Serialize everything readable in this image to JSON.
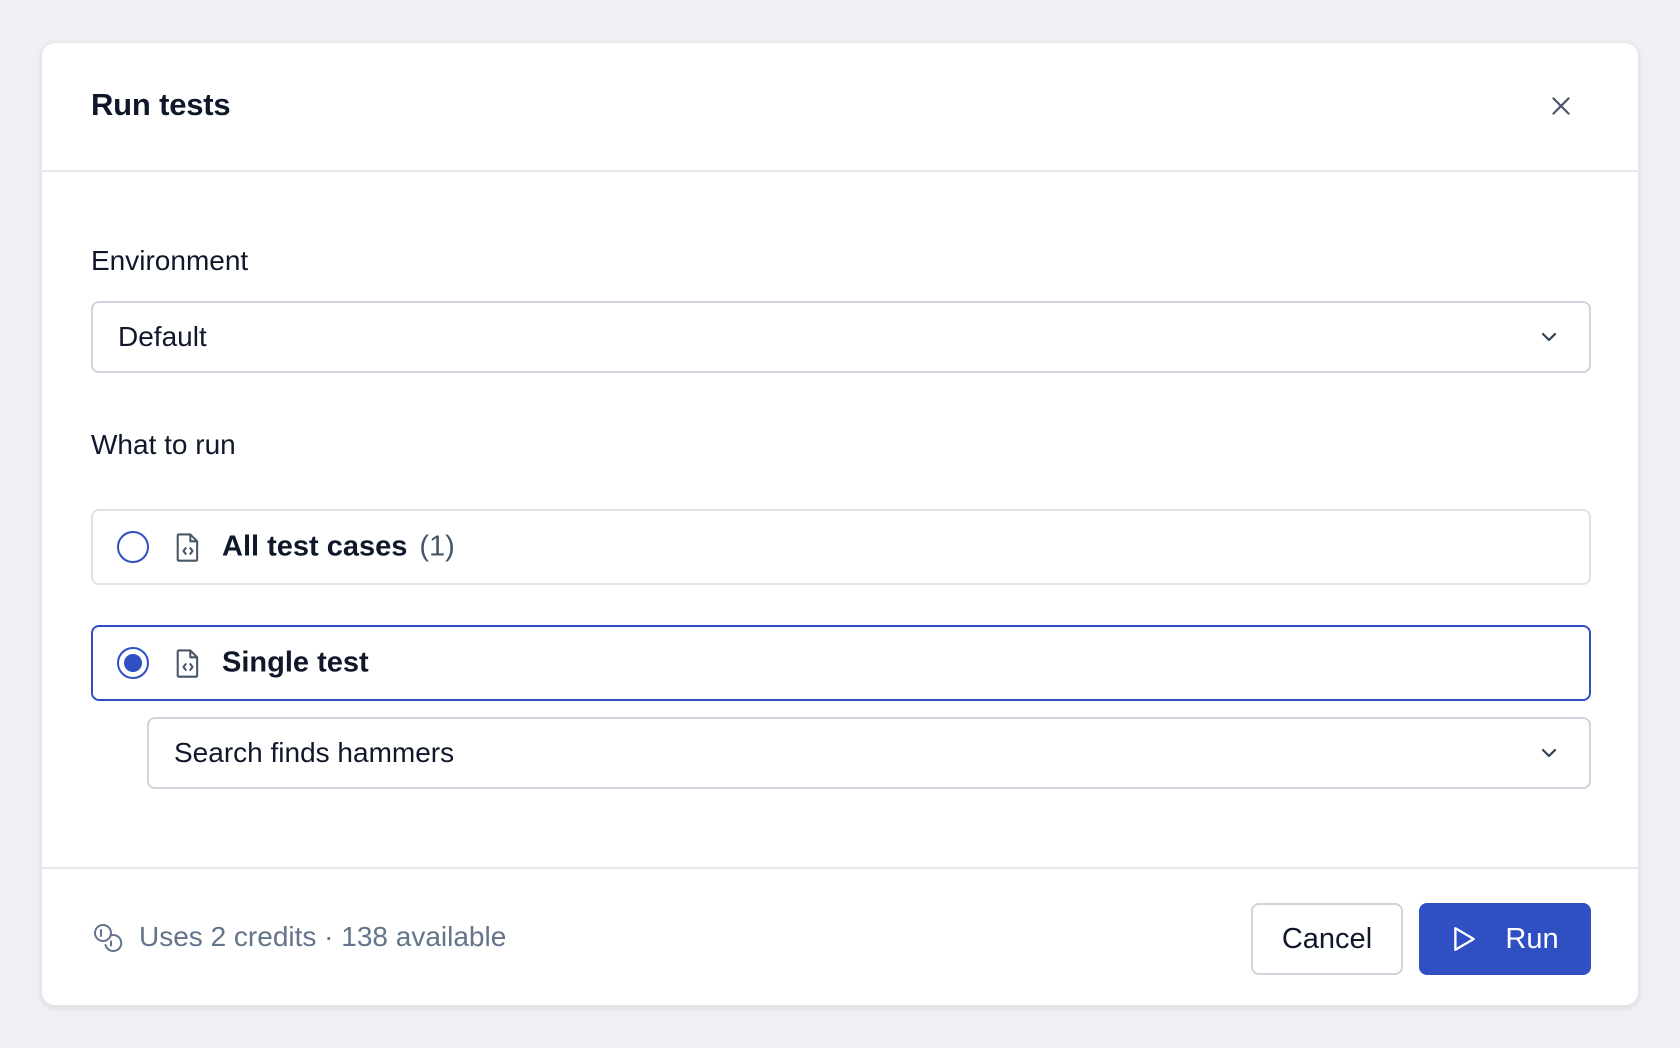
{
  "dialog": {
    "title": "Run tests",
    "close_icon": "close-icon"
  },
  "environment": {
    "label": "Environment",
    "selected": "Default"
  },
  "what_to_run": {
    "label": "What to run",
    "options": [
      {
        "label": "All test cases",
        "count": "(1)",
        "selected": false,
        "icon": "file-code-icon"
      },
      {
        "label": "Single test",
        "count": "",
        "selected": true,
        "icon": "file-code-icon"
      }
    ],
    "single_test_selected": "Search finds hammers"
  },
  "footer": {
    "credits_text": "Uses 2 credits · 138 available",
    "credits_icon": "coins-icon",
    "cancel_label": "Cancel",
    "run_label": "Run",
    "run_icon": "play-icon"
  },
  "colors": {
    "accent": "#2f4fc3",
    "border": "#cfd4dc",
    "text": "#0f172a",
    "muted": "#64748b"
  }
}
